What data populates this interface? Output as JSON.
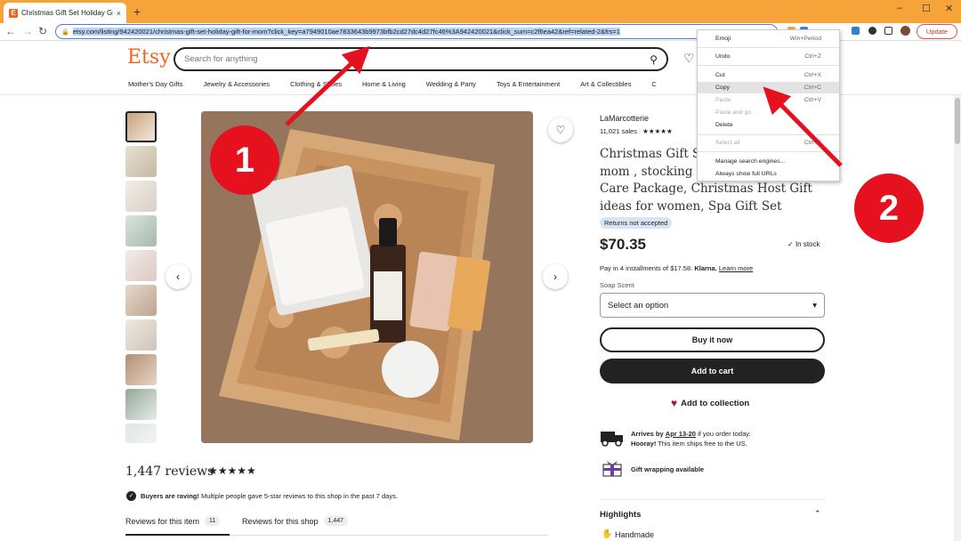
{
  "browser": {
    "tab_title": "Christmas Gift Set Holiday Gift fo",
    "tab_close": "×",
    "new_tab": "+",
    "url": "etsy.com/listing/942420021/christmas-gift-set-holiday-gift-for-mom?click_key=a7949010ae7833643b9973bfb2cd27dc4d27fc46%3A942420021&click_sum=c2f6ea42&ref=related-2&frs=1",
    "update_label": "Update",
    "win_min": "–",
    "win_max": "☐",
    "win_close": "✕"
  },
  "header": {
    "logo": "Etsy",
    "search_placeholder": "Search for anything",
    "categories": [
      "Mother's Day Gifts",
      "Jewelry & Accessories",
      "Clothing & Shoes",
      "Home & Living",
      "Wedding & Party",
      "Toys & Entertainment",
      "Art & Collectibles",
      "C"
    ]
  },
  "product": {
    "shop_name": "LaMarcotterie",
    "sales": "11,021 sales",
    "shop_stars": "★★★★★",
    "title": "Christmas Gift Se... mom , stocking s... Care Package, Christmas Host Gift ideas for women, Spa Gift Set",
    "title_lines": [
      "Christmas Gift Se",
      "mom , stocking s",
      "Care Package, Christmas Host Gift",
      "ideas for women, Spa Gift Set"
    ],
    "returns": "Returns not accepted",
    "price": "$70.35",
    "in_stock": "In stock",
    "installments_prefix": "Pay in 4 installments of $17.58.",
    "klarna": "Klarna.",
    "learn_more": "Learn more",
    "scent_label": "Soap Scent",
    "select_default": "Select an option",
    "buy_now": "Buy it now",
    "add_to_cart": "Add to cart",
    "add_to_collection": "Add to collection",
    "arrives_prefix": "Arrives by",
    "arrives_date": "Apr 13-20",
    "arrives_suffix": "if you order today.",
    "hooray": "Hooray!",
    "hooray_text": "This item ships free to the US.",
    "gift_wrapping": "Gift wrapping available",
    "highlights": "Highlights",
    "handmade": "Handmade"
  },
  "reviews": {
    "title": "1,447 reviews",
    "stars": "★★★★★",
    "raving_bold": "Buyers are raving!",
    "raving_text": "Multiple people gave 5-star reviews to this shop in the past 7 days.",
    "tab_item": "Reviews for this item",
    "tab_item_count": "11",
    "tab_shop": "Reviews for this shop",
    "tab_shop_count": "1,447"
  },
  "context_menu": {
    "items": [
      {
        "label": "Emoji",
        "shortcut": "Win+Period"
      },
      {
        "label": "Undo",
        "shortcut": "Ctrl+Z"
      },
      {
        "label": "Cut",
        "shortcut": "Ctrl+X"
      },
      {
        "label": "Copy",
        "shortcut": "Ctrl+C"
      },
      {
        "label": "Paste",
        "shortcut": "Ctrl+V"
      },
      {
        "label": "Paste and go",
        "shortcut": ""
      },
      {
        "label": "Delete",
        "shortcut": ""
      },
      {
        "label": "Select all",
        "shortcut": "Ctrl+A"
      },
      {
        "label": "Manage search engines...",
        "shortcut": ""
      },
      {
        "label": "Always show full URLs",
        "shortcut": ""
      }
    ]
  },
  "annotations": {
    "badge1": "1",
    "badge2": "2",
    "arrow_color": "#e5111f"
  }
}
